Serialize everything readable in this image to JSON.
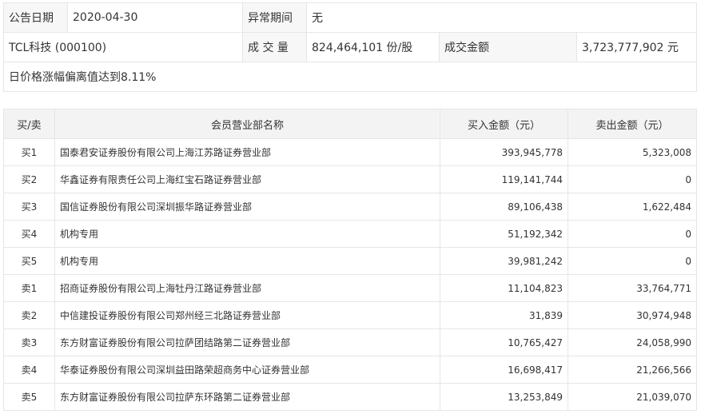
{
  "info": {
    "announce_date_label": "公告日期",
    "announce_date": "2020-04-30",
    "abnormal_period_label": "异常期间",
    "abnormal_period": "无",
    "stock_name": "TCL科技 (000100)",
    "volume_label": "成 交 量",
    "volume": "824,464,101 份/股",
    "turnover_label": "成交金额",
    "turnover": "3,723,777,902 元",
    "reason": "日价格涨幅偏离值达到8.11%"
  },
  "trades": {
    "headers": {
      "side": "买/卖",
      "branch": "会员营业部名称",
      "buy": "买入金额（元）",
      "sell": "卖出金额（元）"
    },
    "rows": [
      {
        "side": "买1",
        "branch": "国泰君安证券股份有限公司上海江苏路证券营业部",
        "buy": "393,945,778",
        "sell": "5,323,008"
      },
      {
        "side": "买2",
        "branch": "华鑫证券有限责任公司上海红宝石路证券营业部",
        "buy": "119,141,744",
        "sell": "0"
      },
      {
        "side": "买3",
        "branch": "国信证券股份有限公司深圳振华路证券营业部",
        "buy": "89,106,438",
        "sell": "1,622,484"
      },
      {
        "side": "买4",
        "branch": "机构专用",
        "buy": "51,192,342",
        "sell": "0"
      },
      {
        "side": "买5",
        "branch": "机构专用",
        "buy": "39,981,242",
        "sell": "0"
      },
      {
        "side": "卖1",
        "branch": "招商证券股份有限公司上海牡丹江路证券营业部",
        "buy": "11,104,823",
        "sell": "33,764,771"
      },
      {
        "side": "卖2",
        "branch": "中信建投证券股份有限公司郑州经三北路证券营业部",
        "buy": "31,839",
        "sell": "30,974,948"
      },
      {
        "side": "卖3",
        "branch": "东方财富证券股份有限公司拉萨团结路第二证券营业部",
        "buy": "10,765,427",
        "sell": "24,058,990"
      },
      {
        "side": "卖4",
        "branch": "华泰证券股份有限公司深圳益田路荣超商务中心证券营业部",
        "buy": "16,698,417",
        "sell": "21,266,566"
      },
      {
        "side": "卖5",
        "branch": "东方财富证券股份有限公司拉萨东环路第二证券营业部",
        "buy": "13,253,849",
        "sell": "21,039,070"
      }
    ]
  }
}
